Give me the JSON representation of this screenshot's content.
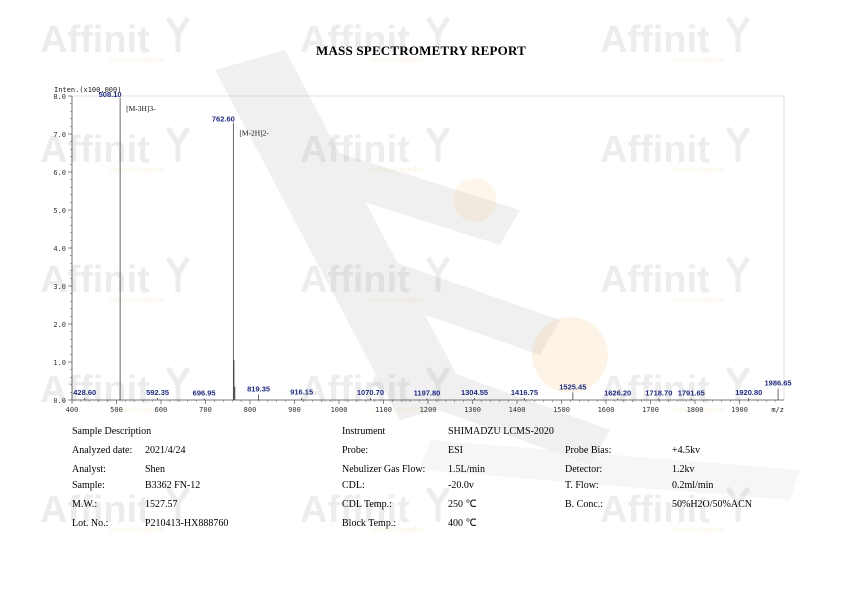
{
  "report": {
    "title": "MASS SPECTROMETRY REPORT",
    "watermark_text": "Affinit",
    "watermark_tagline": "research together"
  },
  "chart_data": {
    "type": "bar",
    "y_axis_title": "Inten.(x100,000)",
    "x_axis_title": "m/z",
    "xlim": [
      400,
      2000
    ],
    "ylim": [
      0,
      8
    ],
    "x_ticks": [
      400,
      500,
      600,
      700,
      800,
      900,
      1000,
      1100,
      1200,
      1300,
      1400,
      1500,
      1600,
      1700,
      1800,
      1900
    ],
    "y_ticks": [
      0,
      1,
      2,
      3,
      4,
      5,
      6,
      7,
      8
    ],
    "y_tick_labels": [
      "0.0",
      "1.0",
      "2.0",
      "3.0",
      "4.0",
      "5.0",
      "6.0",
      "7.0",
      "8.0"
    ],
    "peaks": [
      {
        "x": 428.6,
        "y": 0.05,
        "label": "428.60"
      },
      {
        "x": 508.1,
        "y": 7.95,
        "label": "508.10"
      },
      {
        "x": 592.35,
        "y": 0.05,
        "label": "592.35"
      },
      {
        "x": 696.95,
        "y": 0.04,
        "label": "696.95"
      },
      {
        "x": 762.6,
        "y": 7.3,
        "label": "762.60"
      },
      {
        "x": 764.0,
        "y": 1.05,
        "label": ""
      },
      {
        "x": 766.0,
        "y": 0.35,
        "label": ""
      },
      {
        "x": 819.35,
        "y": 0.15,
        "label": "819.35"
      },
      {
        "x": 916.15,
        "y": 0.06,
        "label": "916.15"
      },
      {
        "x": 1070.7,
        "y": 0.05,
        "label": "1070.70"
      },
      {
        "x": 1197.8,
        "y": 0.04,
        "label": "1197.80"
      },
      {
        "x": 1304.55,
        "y": 0.05,
        "label": "1304.55"
      },
      {
        "x": 1416.75,
        "y": 0.05,
        "label": "1416.75"
      },
      {
        "x": 1525.45,
        "y": 0.2,
        "label": "1525.45"
      },
      {
        "x": 1626.2,
        "y": 0.04,
        "label": "1626.20"
      },
      {
        "x": 1718.7,
        "y": 0.04,
        "label": "1718.70"
      },
      {
        "x": 1791.65,
        "y": 0.04,
        "label": "1791.65"
      },
      {
        "x": 1920.8,
        "y": 0.05,
        "label": "1920.80"
      },
      {
        "x": 1986.65,
        "y": 0.3,
        "label": "1986.65"
      }
    ],
    "annotations": [
      {
        "x": 508.1,
        "text": "[M-3H]3-"
      },
      {
        "x": 762.6,
        "text": "[M-2H]2-"
      }
    ],
    "colors": {
      "axis": "#555555",
      "peak": "#444444",
      "label": "#1f2a80"
    }
  },
  "info": {
    "sample_description_label": "Sample Description",
    "analyzed_date_label": "Analyzed date:",
    "analyzed_date": "2021/4/24",
    "analyst_label": "Analyst:",
    "analyst": "Shen",
    "sample_label": "Sample:",
    "sample": "B3362 FN-12",
    "mw_label": "M.W.:",
    "mw": "1527.57",
    "lot_label": "Lot. No.:",
    "lot": "P210413-HX888760",
    "instrument_label": "Instrument",
    "instrument": "SHIMADZU LCMS-2020",
    "probe_label": "Probe:",
    "probe": "ESI",
    "nebulizer_label": "Nebulizer Gas Flow:",
    "nebulizer": "1.5L/min",
    "cdl_label": "CDL:",
    "cdl": "-20.0v",
    "cdl_temp_label": "CDL Temp.:",
    "cdl_temp": "250 ℃",
    "block_temp_label": "Block Temp.:",
    "block_temp": "400 ℃",
    "probe_bias_label": "Probe Bias:",
    "probe_bias": "+4.5kv",
    "detector_label": "Detector:",
    "detector": "1.2kv",
    "tflow_label": "T. Flow:",
    "tflow": "0.2ml/min",
    "bconc_label": "B. Conc.:",
    "bconc": "50%H2O/50%ACN"
  }
}
